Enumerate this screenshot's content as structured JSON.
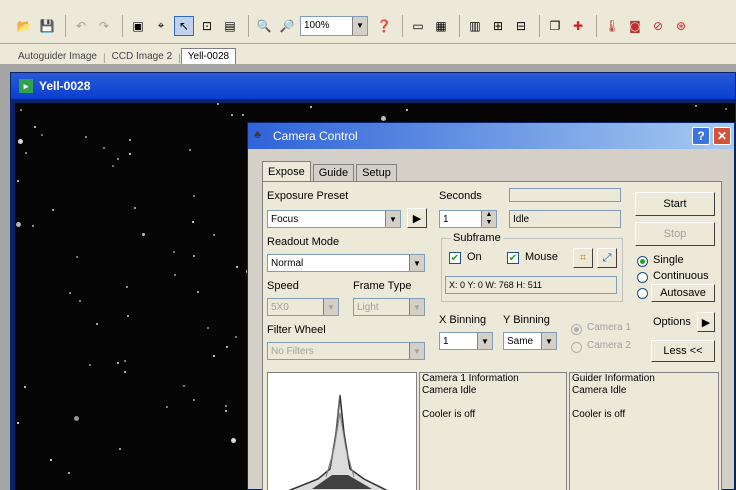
{
  "toolbar": {
    "zoom": "100%"
  },
  "doc_tabs": [
    {
      "label": "Autoguider Image"
    },
    {
      "label": "CCD Image 2"
    },
    {
      "label": "Yell-0028"
    }
  ],
  "image_window": {
    "title": "Yell-0028"
  },
  "camera_dialog": {
    "title": "Camera Control",
    "tabs": [
      {
        "label": "Expose"
      },
      {
        "label": "Guide"
      },
      {
        "label": "Setup"
      }
    ],
    "exposure_preset": {
      "label": "Exposure Preset",
      "value": "Focus"
    },
    "seconds": {
      "label": "Seconds",
      "value": "1"
    },
    "status": "Idle",
    "readout_mode": {
      "label": "Readout Mode",
      "value": "Normal"
    },
    "speed": {
      "label": "Speed",
      "value": "5X0"
    },
    "frame_type": {
      "label": "Frame Type",
      "value": "Light"
    },
    "filter_wheel": {
      "label": "Filter Wheel",
      "value": "No Filters"
    },
    "subframe": {
      "label": "Subframe",
      "on_label": "On",
      "mouse_label": "Mouse",
      "coords": "X:   0 Y:    0 W:  768 H:  511"
    },
    "x_binning": {
      "label": "X Binning",
      "value": "1"
    },
    "y_binning": {
      "label": "Y Binning",
      "value": "Same"
    },
    "camera_select": {
      "camera1": "Camera 1",
      "camera2": "Camera 2"
    },
    "buttons": {
      "start": "Start",
      "stop": "Stop",
      "autosave": "Autosave",
      "options": "Options",
      "less": "Less <<"
    },
    "mode": {
      "single": "Single",
      "continuous": "Continuous"
    },
    "camera1_info": {
      "heading": "Camera 1 Information",
      "status": "Camera Idle",
      "cooler": "Cooler is off"
    },
    "guider_info": {
      "heading": "Guider Information",
      "status": "Camera Idle",
      "cooler": "Cooler is off"
    }
  }
}
